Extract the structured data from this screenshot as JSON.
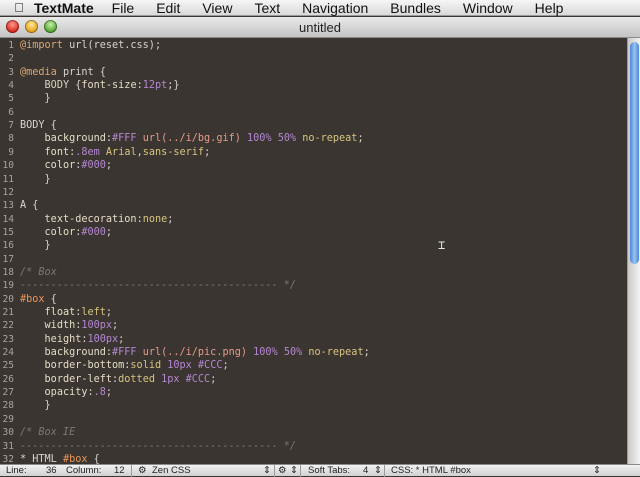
{
  "menubar": {
    "app_name": "TextMate",
    "items": [
      "File",
      "Edit",
      "View",
      "Text",
      "Navigation",
      "Bundles",
      "Window",
      "Help"
    ]
  },
  "window": {
    "title": "untitled"
  },
  "editor": {
    "lines": [
      "@import url(reset.css);",
      "",
      "@media print {",
      "    BODY {font-size:12pt;}",
      "    }",
      "",
      "BODY {",
      "    background:#FFF url(../i/bg.gif) 100% 50% no-repeat;",
      "    font:.8em Arial,sans-serif;",
      "    color:#000;",
      "    }",
      "",
      "A {",
      "    text-decoration:none;",
      "    color:#000;",
      "    }",
      "",
      "/* Box",
      "------------------------------------------ */",
      "#box {",
      "    float:left;",
      "    width:100px;",
      "    height:100px;",
      "    background:#FFF url(../i/pic.png) 100% 50% no-repeat;",
      "    border-bottom:solid 10px #CCC;",
      "    border-left:dotted 1px #CCC;",
      "    opacity:.8;",
      "    }",
      "",
      "/* Box IE",
      "------------------------------------------ */",
      "* HTML #box {"
    ]
  },
  "statusbar": {
    "line_label": "Line:",
    "line_value": "36",
    "column_label": "Column:",
    "column_value": "12",
    "theme": "Zen CSS",
    "tabs_label": "Soft Tabs:",
    "tabs_value": "4",
    "scope": "CSS: * HTML #box"
  }
}
